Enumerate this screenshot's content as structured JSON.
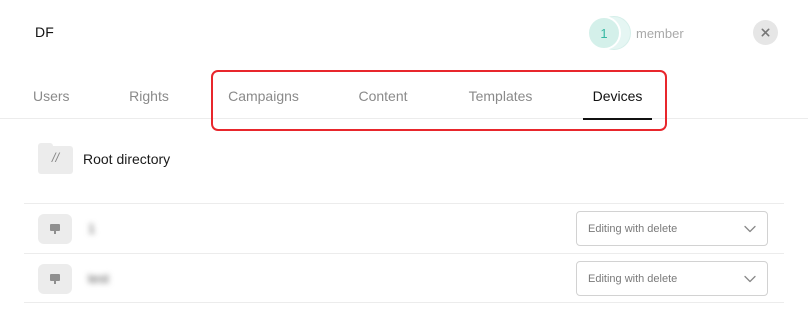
{
  "header": {
    "group_name": "DF",
    "member_count": "1",
    "member_label": "member",
    "close_icon": "close-icon"
  },
  "tabs": [
    {
      "label": "Users",
      "active": false
    },
    {
      "label": "Rights",
      "active": false
    },
    {
      "label": "Campaigns",
      "active": false
    },
    {
      "label": "Content",
      "active": false
    },
    {
      "label": "Templates",
      "active": false
    },
    {
      "label": "Devices",
      "active": true
    }
  ],
  "directory": {
    "label": "Root directory",
    "icon_text": "//"
  },
  "devices": [
    {
      "name": "1",
      "permission": "Editing with delete"
    },
    {
      "name": "test",
      "permission": "Editing with delete"
    }
  ],
  "colors": {
    "accent": "#35b8a2",
    "highlight": "#e8262c"
  }
}
